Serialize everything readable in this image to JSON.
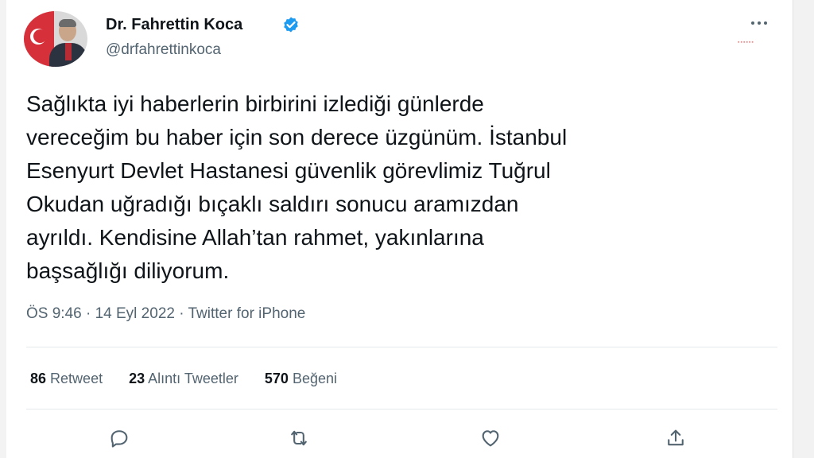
{
  "author": {
    "name": "Dr. Fahrettin Koca",
    "handle": "@drfahrettinkoca",
    "verified": true
  },
  "tweet": {
    "text": "Sağlıkta iyi haberlerin birbirini izlediği günlerde\nvereceğim bu haber için son derece üzgünüm. İstanbul\nEsenyurt Devlet Hastanesi güvenlik görevlimiz Tuğrul\nOkudan uğradığı bıçaklı saldırı sonucu aramızdan\nayrıldı. Kendisine Allah’tan rahmet, yakınlarına\nbaşsağlığı diliyorum.",
    "meta": "ÖS 9:46 · 14 Eyl 2022 · Twitter for iPhone"
  },
  "stats": [
    {
      "count": "86",
      "label": "Retweet"
    },
    {
      "count": "23",
      "label": "Alıntı Tweetler"
    },
    {
      "count": "570",
      "label": "Beğeni"
    }
  ],
  "actions": [
    {
      "icon": "reply-icon"
    },
    {
      "icon": "retweet-icon"
    },
    {
      "icon": "like-icon"
    },
    {
      "icon": "share-icon"
    }
  ],
  "colors": {
    "text": "#0f1419",
    "secondary": "#536471",
    "verified": "#1d9bf0",
    "divider": "#e6e9eb"
  }
}
